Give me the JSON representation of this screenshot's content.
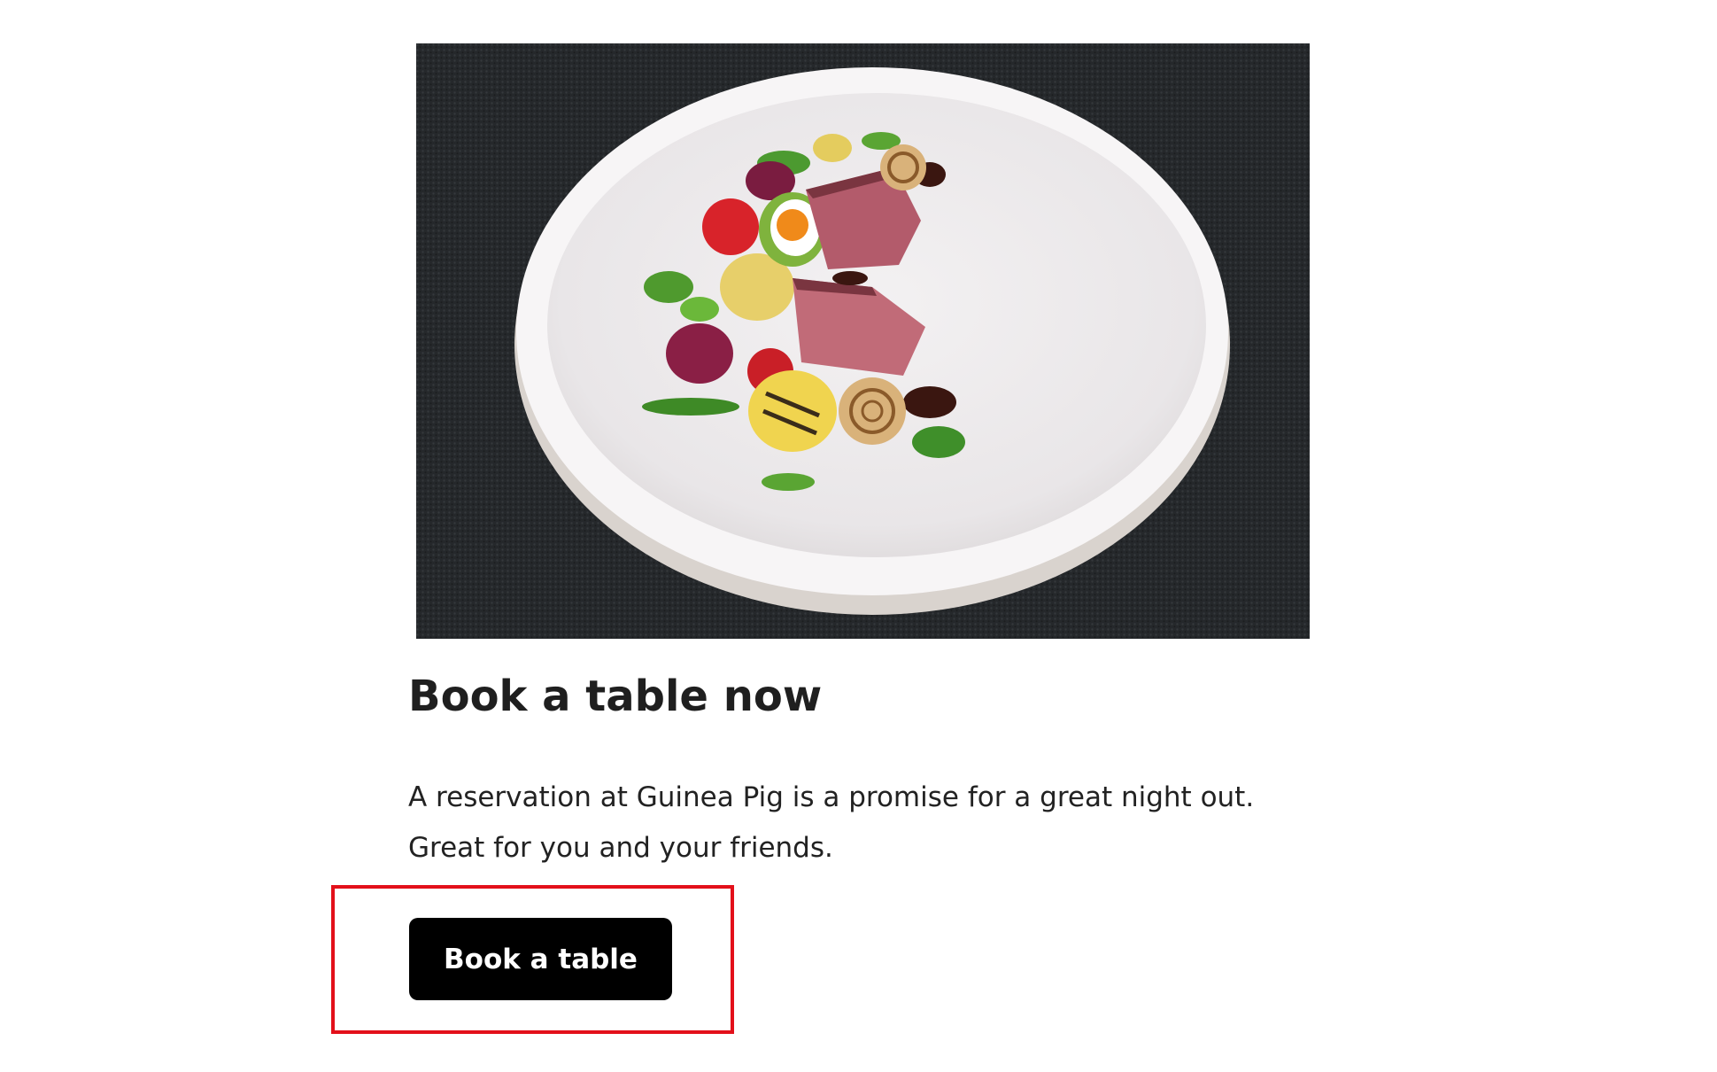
{
  "hero": {
    "alt": "Plated dish: sliced duck breast with quail egg, grilled potatoes, cherry tomatoes, onions and greens on a white plate"
  },
  "section": {
    "title": "Book a table now",
    "description": "A reservation at Guinea Pig is a promise for a great night out. Great for you and your friends."
  },
  "cta": {
    "label": "Book a table"
  },
  "colors": {
    "button_bg": "#000000",
    "button_text": "#ffffff",
    "highlight": "#e3101a"
  }
}
